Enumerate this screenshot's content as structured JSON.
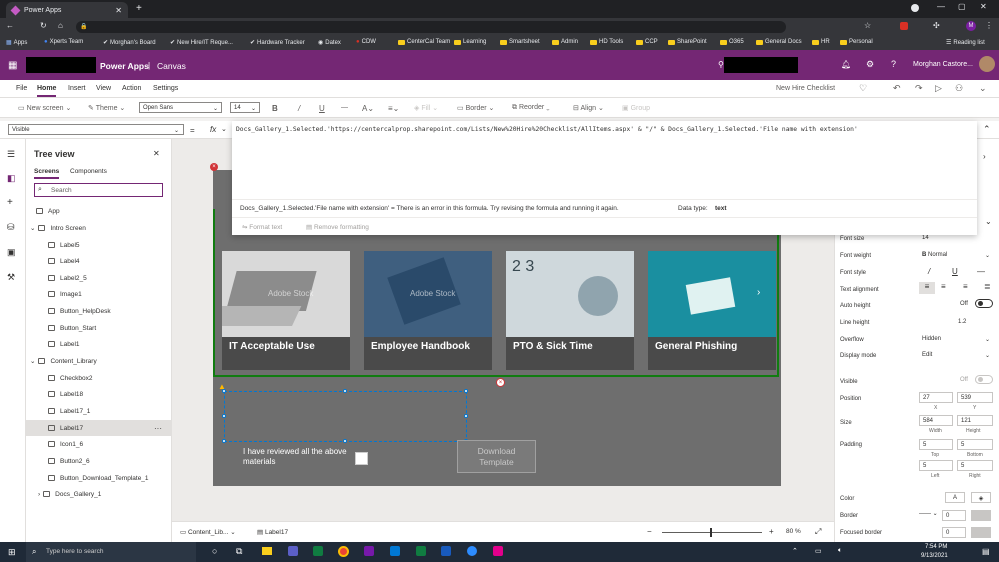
{
  "browser": {
    "tab_title": "Power Apps",
    "bookmarks": [
      "Apps",
      "Xperts Team",
      "Morghan's Board",
      "New Hire/IT Reque...",
      "Hardware Tracker",
      "Datex",
      "CDW",
      "CenterCal Team",
      "Learning",
      "Smartsheet",
      "Admin",
      "HD Tools",
      "CCP",
      "SharePoint",
      "O365",
      "General Docs",
      "HR",
      "Personal"
    ],
    "reading_list": "Reading list"
  },
  "header": {
    "product": "Power Apps",
    "separator": "|",
    "canvas": "Canvas",
    "user": "Morghan Castore..."
  },
  "commands": {
    "file": "File",
    "home": "Home",
    "insert": "Insert",
    "view": "View",
    "action": "Action",
    "settings": "Settings",
    "app_title": "New Hire Checklist"
  },
  "toolbar": {
    "new_screen": "New screen",
    "theme": "Theme",
    "font": "Open Sans",
    "size": "14",
    "bold": "B",
    "italic": "/",
    "underline": "U",
    "strike": "—",
    "fill": "Fill",
    "border": "Border",
    "reorder": "Reorder",
    "align": "Align",
    "group": "Group"
  },
  "formula": {
    "property": "Visible",
    "fx": "fx",
    "expression": "Docs_Gallery_1.Selected.'https://centercalprop.sharepoint.com/Lists/New%20Hire%20Checklist/AllItems.aspx' & \"/\" & Docs_Gallery_1.Selected.'File name with extension'",
    "error": "Docs_Gallery_1.Selected.'File name with extension' = There is an error in this formula. Try revising the formula and running it again.",
    "datatype_label": "Data type:",
    "datatype": "text",
    "format_text": "Format text",
    "remove_formatting": "Remove formatting"
  },
  "tree": {
    "title": "Tree view",
    "tab_screens": "Screens",
    "tab_components": "Components",
    "search_placeholder": "Search",
    "items": [
      "App",
      "Intro Screen",
      "Label5",
      "Label4",
      "Label2_5",
      "Image1",
      "Button_HelpDesk",
      "Button_Start",
      "Label1",
      "Content_Library",
      "Checkbox2",
      "Label18",
      "Label17_1",
      "Label17",
      "Icon1_6",
      "Button2_6",
      "Button_Download_Template_1",
      "Docs_Gallery_1"
    ],
    "more": "···"
  },
  "canvas": {
    "cards": [
      "IT Acceptable Use",
      "Employee Handbook",
      "PTO & Sick Time",
      "General Phishing"
    ],
    "watermark": "Adobe Stock",
    "checkbox_label": "I have reviewed all the above materials",
    "download": "Download Template"
  },
  "props": {
    "font_size_label": "Font size",
    "font_size": "14",
    "font_weight_label": "Font weight",
    "font_weight": "Normal",
    "font_style_label": "Font style",
    "text_align_label": "Text alignment",
    "auto_height_label": "Auto height",
    "auto_height": "Off",
    "line_height_label": "Line height",
    "line_height": "1.2",
    "overflow_label": "Overflow",
    "overflow": "Hidden",
    "display_mode_label": "Display mode",
    "display_mode": "Edit",
    "visible_label": "Visible",
    "visible": "Off",
    "position_label": "Position",
    "pos_x": "27",
    "pos_y": "539",
    "x_label": "X",
    "y_label": "Y",
    "size_label": "Size",
    "width": "584",
    "height": "121",
    "width_label": "Width",
    "height_label": "Height",
    "padding_label": "Padding",
    "pad_top": "5",
    "pad_bottom": "5",
    "pad_left": "5",
    "pad_right": "5",
    "top_label": "Top",
    "bottom_label": "Bottom",
    "left_label": "Left",
    "right_label": "Right",
    "color_label": "Color",
    "color_a": "A",
    "border_label": "Border",
    "border_val": "0",
    "focused_border_label": "Focused border",
    "focused_val": "0"
  },
  "status": {
    "screen": "Content_Lib...",
    "control": "Label17",
    "zoom": "80 %"
  },
  "taskbar": {
    "search": "Type here to search",
    "time": "7:54 PM",
    "date": "9/13/2021"
  }
}
